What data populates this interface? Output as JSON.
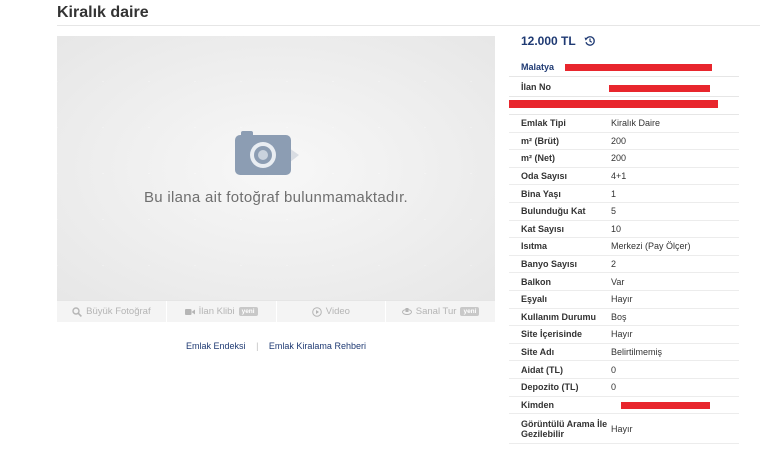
{
  "title": "Kiralık daire",
  "gallery": {
    "no_photo_text": "Bu ilana ait fotoğraf bulunmamaktadır.",
    "buttons": [
      {
        "label": "Büyük Fotoğraf",
        "icon": "magnifier-icon",
        "badge": ""
      },
      {
        "label": "İlan Klibi",
        "icon": "video-camera-icon",
        "badge": "yeni"
      },
      {
        "label": "Video",
        "icon": "play-icon",
        "badge": ""
      },
      {
        "label": "Sanal Tur",
        "icon": "panorama-icon",
        "badge": "yeni"
      }
    ]
  },
  "links": {
    "first": "Emlak Endeksi",
    "sep": "|",
    "second": "Emlak Kiralama Rehberi"
  },
  "summary": {
    "price": "12.000 TL",
    "location": "Malatya",
    "listing_no_label": "İlan No"
  },
  "specs": [
    {
      "k": "Emlak Tipi",
      "v": "Kiralık Daire"
    },
    {
      "k": "m² (Brüt)",
      "v": "200"
    },
    {
      "k": "m² (Net)",
      "v": "200"
    },
    {
      "k": "Oda Sayısı",
      "v": "4+1"
    },
    {
      "k": "Bina Yaşı",
      "v": "1"
    },
    {
      "k": "Bulunduğu Kat",
      "v": "5"
    },
    {
      "k": "Kat Sayısı",
      "v": "10"
    },
    {
      "k": "Isıtma",
      "v": "Merkezi (Pay Ölçer)"
    },
    {
      "k": "Banyo Sayısı",
      "v": "2"
    },
    {
      "k": "Balkon",
      "v": "Var"
    },
    {
      "k": "Eşyalı",
      "v": "Hayır"
    },
    {
      "k": "Kullanım Durumu",
      "v": "Boş"
    },
    {
      "k": "Site İçerisinde",
      "v": "Hayır"
    },
    {
      "k": "Site Adı",
      "v": "Belirtilmemiş"
    },
    {
      "k": "Aidat (TL)",
      "v": "0"
    },
    {
      "k": "Depozito (TL)",
      "v": "0"
    },
    {
      "k": "Kimden",
      "v": ""
    },
    {
      "k": "Görüntülü Arama İle Gezilebilir",
      "v": "Hayır"
    }
  ],
  "colors": {
    "brand_blue": "#1f3a73",
    "redaction": "#e8262d"
  }
}
